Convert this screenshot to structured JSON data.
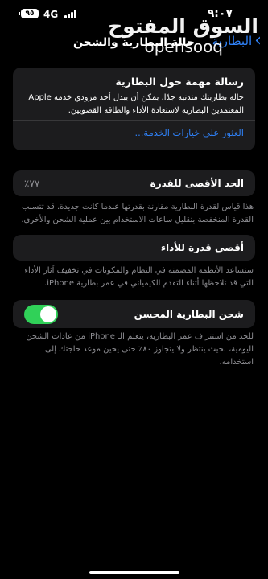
{
  "status_bar": {
    "time": "٩:٠٧",
    "network": "4G",
    "battery": "٩٥"
  },
  "nav": {
    "back_label": "البطارية",
    "title": "حالة البطارية والشحن"
  },
  "watermark": {
    "arabic": "السوق المفتوح",
    "english": "opensooq"
  },
  "message_card": {
    "title": "رسالة مهمة حول البطارية",
    "body": "حالة بطاريتك متدنية جدًا. يمكن أن يبدل أحد مزودي خدمة Apple المعتمدين البطارية لاستعادة الأداء والطاقة القصويين.",
    "link": "العثور على خيارات الخدمة..."
  },
  "maximum_capacity": {
    "label": "الحد الأقصى للقدرة",
    "value": "٪٧٧",
    "note": "هذا قياس لقدرة البطارية مقارنة بقدرتها عندما كانت جديدة. قد تتسبب القدرة المنخفضة بتقليل ساعات الاستخدام بين عملية الشحن والأخرى."
  },
  "peak_performance": {
    "label": "أقصى قدرة للأداء",
    "note": "ستساعد الأنظمة المضمنة في النظام والمكونات في تخفيف آثار الأداء التي قد تلاحظها أثناء التقدم الكيميائي في عمر بطارية iPhone."
  },
  "optimized_charging": {
    "label": "شحن البطارية المحسن",
    "enabled": true,
    "note": "للحد من استنزاف عمر البطارية، يتعلم الـ iPhone من عادات الشحن اليومية، بحيث ينتظر ولا يتجاوز ٨٠٪ حتى يحين موعد حاجتك إلى استخدامه."
  },
  "colors": {
    "background": "#000000",
    "card": "#1c1c1e",
    "link": "#2f81f7",
    "toggle_on": "#30d158",
    "secondary_text": "#8e8e93"
  }
}
